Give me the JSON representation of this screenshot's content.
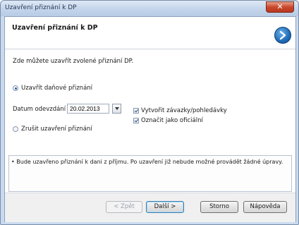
{
  "window": {
    "title": "Uzavření přiznání k DP",
    "close_label": "✕"
  },
  "header": {
    "title": "Uzavření přiznání k DP",
    "logo_icon": "arrow-circle-icon"
  },
  "body": {
    "description": "Zde můžete uzavřít zvolené přiznání DP.",
    "options": {
      "close_return": {
        "label": "Uzavřít daňové přiznání",
        "selected": true
      },
      "cancel_close": {
        "label": "Zrušit uzavření přiznání",
        "selected": false
      }
    },
    "date_field": {
      "label": "Datum odevzdání",
      "value": "20.02.2013"
    },
    "checkboxes": {
      "create_liabilities": {
        "label": "Vytvořit závazky/pohledávky",
        "checked": true
      },
      "mark_official": {
        "label": "Označit jako oficiální",
        "checked": true
      }
    },
    "info_text": "• Bude uzavřeno přiznání k dani z příjmu. Po uzavření již nebude možné provádět žádné úpravy."
  },
  "footer": {
    "back_label": "< Zpět",
    "next_label": "Další >",
    "cancel_label": "Storno",
    "help_label": "Nápověda"
  },
  "colors": {
    "accent": "#1f6bb8",
    "close_button": "#c9472c"
  }
}
